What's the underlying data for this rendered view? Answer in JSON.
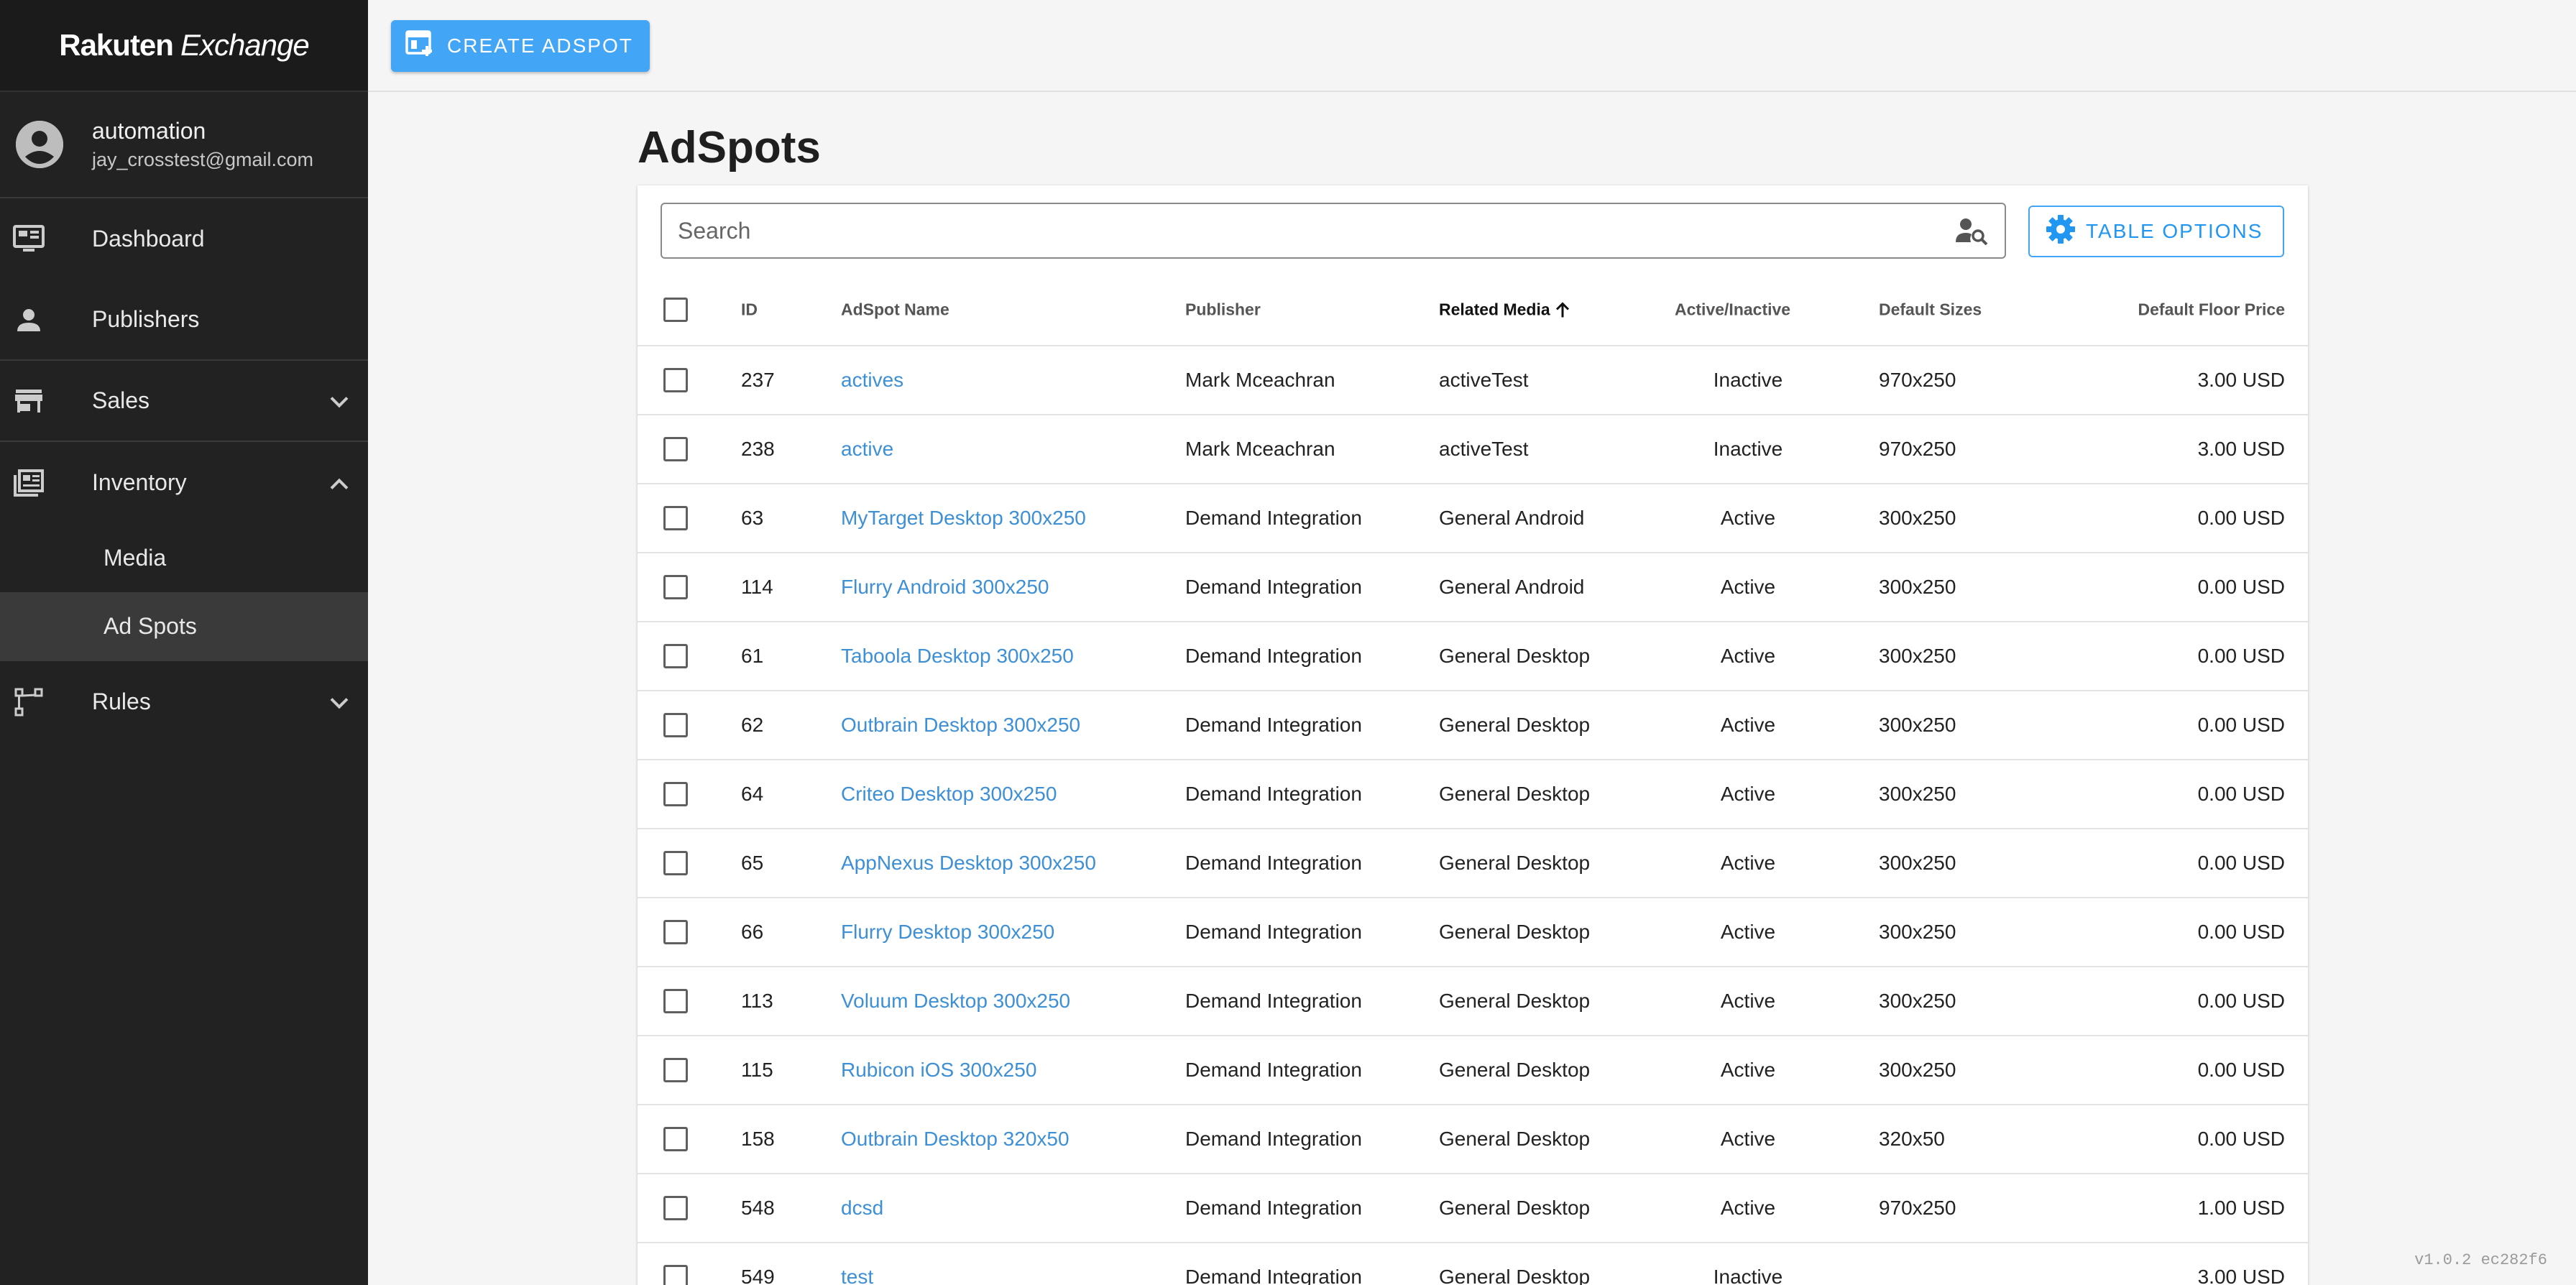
{
  "brand": {
    "part1": "Rakuten",
    "part2": "Exchange"
  },
  "user": {
    "name": "automation",
    "email": "jay_crosstest@gmail.com"
  },
  "nav": {
    "dashboard": "Dashboard",
    "publishers": "Publishers",
    "sales": "Sales",
    "inventory": "Inventory",
    "media": "Media",
    "ad_spots": "Ad Spots",
    "rules": "Rules"
  },
  "toolbar": {
    "create_label": "CREATE ADSPOT"
  },
  "page": {
    "title": "AdSpots"
  },
  "search": {
    "placeholder": "Search"
  },
  "table_options": {
    "label": "TABLE OPTIONS"
  },
  "table": {
    "columns": {
      "id": "ID",
      "name": "AdSpot Name",
      "publisher": "Publisher",
      "media": "Related Media",
      "status": "Active/Inactive",
      "sizes": "Default Sizes",
      "price": "Default Floor Price"
    },
    "sort": {
      "column": "Related Media",
      "direction": "ascending"
    },
    "rows": [
      {
        "id": "237",
        "name": "actives",
        "publisher": "Mark Mceachran",
        "media": "activeTest",
        "status": "Inactive",
        "sizes": "970x250",
        "price": "3.00 USD"
      },
      {
        "id": "238",
        "name": "active",
        "publisher": "Mark Mceachran",
        "media": "activeTest",
        "status": "Inactive",
        "sizes": "970x250",
        "price": "3.00 USD"
      },
      {
        "id": "63",
        "name": "MyTarget Desktop 300x250",
        "publisher": "Demand Integration",
        "media": "General Android",
        "status": "Active",
        "sizes": "300x250",
        "price": "0.00 USD"
      },
      {
        "id": "114",
        "name": "Flurry Android 300x250",
        "publisher": "Demand Integration",
        "media": "General Android",
        "status": "Active",
        "sizes": "300x250",
        "price": "0.00 USD"
      },
      {
        "id": "61",
        "name": "Taboola Desktop 300x250",
        "publisher": "Demand Integration",
        "media": "General Desktop",
        "status": "Active",
        "sizes": "300x250",
        "price": "0.00 USD"
      },
      {
        "id": "62",
        "name": "Outbrain Desktop 300x250",
        "publisher": "Demand Integration",
        "media": "General Desktop",
        "status": "Active",
        "sizes": "300x250",
        "price": "0.00 USD"
      },
      {
        "id": "64",
        "name": "Criteo Desktop 300x250",
        "publisher": "Demand Integration",
        "media": "General Desktop",
        "status": "Active",
        "sizes": "300x250",
        "price": "0.00 USD"
      },
      {
        "id": "65",
        "name": "AppNexus Desktop 300x250",
        "publisher": "Demand Integration",
        "media": "General Desktop",
        "status": "Active",
        "sizes": "300x250",
        "price": "0.00 USD"
      },
      {
        "id": "66",
        "name": "Flurry Desktop 300x250",
        "publisher": "Demand Integration",
        "media": "General Desktop",
        "status": "Active",
        "sizes": "300x250",
        "price": "0.00 USD"
      },
      {
        "id": "113",
        "name": "Voluum Desktop 300x250",
        "publisher": "Demand Integration",
        "media": "General Desktop",
        "status": "Active",
        "sizes": "300x250",
        "price": "0.00 USD"
      },
      {
        "id": "115",
        "name": "Rubicon iOS 300x250",
        "publisher": "Demand Integration",
        "media": "General Desktop",
        "status": "Active",
        "sizes": "300x250",
        "price": "0.00 USD"
      },
      {
        "id": "158",
        "name": "Outbrain Desktop 320x50",
        "publisher": "Demand Integration",
        "media": "General Desktop",
        "status": "Active",
        "sizes": "320x50",
        "price": "0.00 USD"
      },
      {
        "id": "548",
        "name": "dcsd",
        "publisher": "Demand Integration",
        "media": "General Desktop",
        "status": "Active",
        "sizes": "970x250",
        "price": "1.00 USD"
      },
      {
        "id": "549",
        "name": "test",
        "publisher": "Demand Integration",
        "media": "General Desktop",
        "status": "Inactive",
        "sizes": "",
        "price": "3.00 USD"
      }
    ]
  },
  "version": "v1.0.2 ec282f6"
}
